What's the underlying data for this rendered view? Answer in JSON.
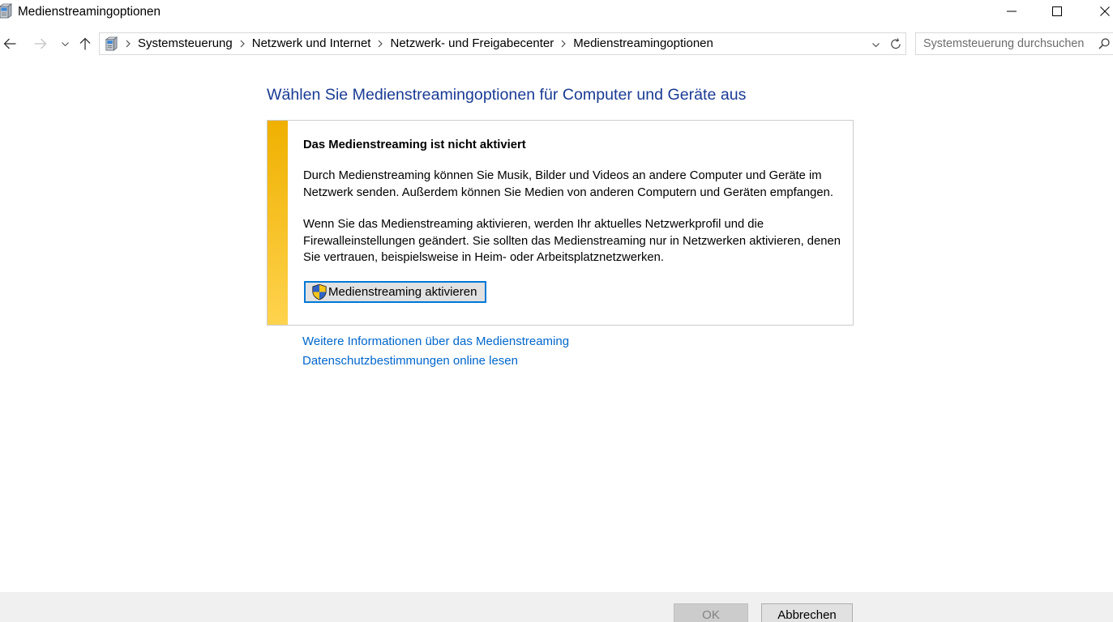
{
  "window": {
    "title": "Medienstreamingoptionen",
    "icon": "control-panel-icon",
    "controls": [
      "minimize-icon",
      "maximize-icon",
      "close-icon"
    ]
  },
  "navigation": {
    "back_icon": "back-arrow-icon",
    "forward_icon": "forward-arrow-icon",
    "recent_icon": "chevron-down-icon",
    "up_icon": "up-arrow-icon"
  },
  "address_bar": {
    "icon": "control-panel-icon",
    "separator_icon": "chevron-right-icon",
    "breadcrumbs": [
      "Systemsteuerung",
      "Netzwerk und Internet",
      "Netzwerk- und Freigabecenter",
      "Medienstreamingoptionen"
    ],
    "dropdown_icon": "chevron-down-icon",
    "refresh_icon": "refresh-icon"
  },
  "search": {
    "placeholder": "Systemsteuerung durchsuchen",
    "value": "",
    "icon": "search-icon"
  },
  "main": {
    "heading": "Wählen Sie Medienstreamingoptionen für Computer und Geräte aus",
    "info_box": {
      "title": "Das Medienstreaming ist nicht aktiviert",
      "paragraphs": [
        [
          "Durch Medienstreaming können Sie Musik, Bilder und Videos an andere Computer und Geräte im",
          "Netzwerk senden. Außerdem können Sie Medien von anderen Computern und Geräten empfangen."
        ],
        [
          "Wenn Sie das Medienstreaming aktivieren, werden Ihr aktuelles Netzwerkprofil und die",
          "Firewalleinstellungen geändert. Sie sollten das Medienstreaming nur in Netzwerken aktivieren, denen",
          "Sie vertrauen, beispielsweise in Heim- oder Arbeitsplatznetzwerken."
        ]
      ],
      "button_label": "Medienstreaming aktivieren",
      "button_icon": "uac-shield-icon"
    },
    "links": [
      "Weitere Informationen über das Medienstreaming",
      "Datenschutzbestimmungen online lesen"
    ]
  },
  "footer": {
    "ok_label": "OK",
    "ok_enabled": false,
    "cancel_label": "Abbrechen"
  },
  "colors": {
    "heading": "#1a3b94",
    "link": "#0066cc",
    "warning_bar_top": "#efb000",
    "warning_bar_bottom": "#ffd34e",
    "primary_button_border": "#0078d7"
  }
}
